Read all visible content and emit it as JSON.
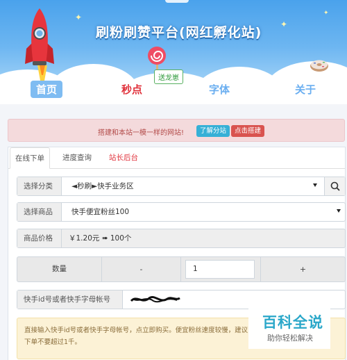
{
  "site": {
    "title": "刷粉刷赞平台(网红孵化站)"
  },
  "sticker": {
    "text": "送龙崽"
  },
  "nav": {
    "home": "首页",
    "second_kill": "秒点",
    "font": "字体",
    "about": "关于"
  },
  "notice": {
    "text": "搭建和本站一模一样的网站!",
    "learn_button": "了解分站",
    "build_button": "点击搭建"
  },
  "tabs": {
    "order": "在线下单",
    "progress": "进度查询",
    "admin": "站长后台"
  },
  "form": {
    "category": {
      "label": "选择分类",
      "value": "◄秒刷►快手业务区"
    },
    "product": {
      "label": "选择商品",
      "value": "快手便宜粉丝100"
    },
    "price": {
      "label": "商品价格",
      "value": "￥1.20元 ➠ 100个"
    },
    "quantity": {
      "label": "数量",
      "minus": "-",
      "value": "1",
      "plus": "+"
    },
    "account": {
      "label": "快手id号或者快手字母帐号"
    }
  },
  "hint": {
    "text": "直接输入快手id号或者快手字母帐号，点立即购买。便宜粉丝速度较慢，建议下单不要超过1千。"
  },
  "watermark": {
    "title": "百科全说",
    "subtitle": "助你轻松解决"
  },
  "colors": {
    "header_blue": "#4aa2ec",
    "active_red": "#e0303a",
    "nav_blue": "#6aaef0",
    "hint_bg": "#fcf2d6"
  }
}
